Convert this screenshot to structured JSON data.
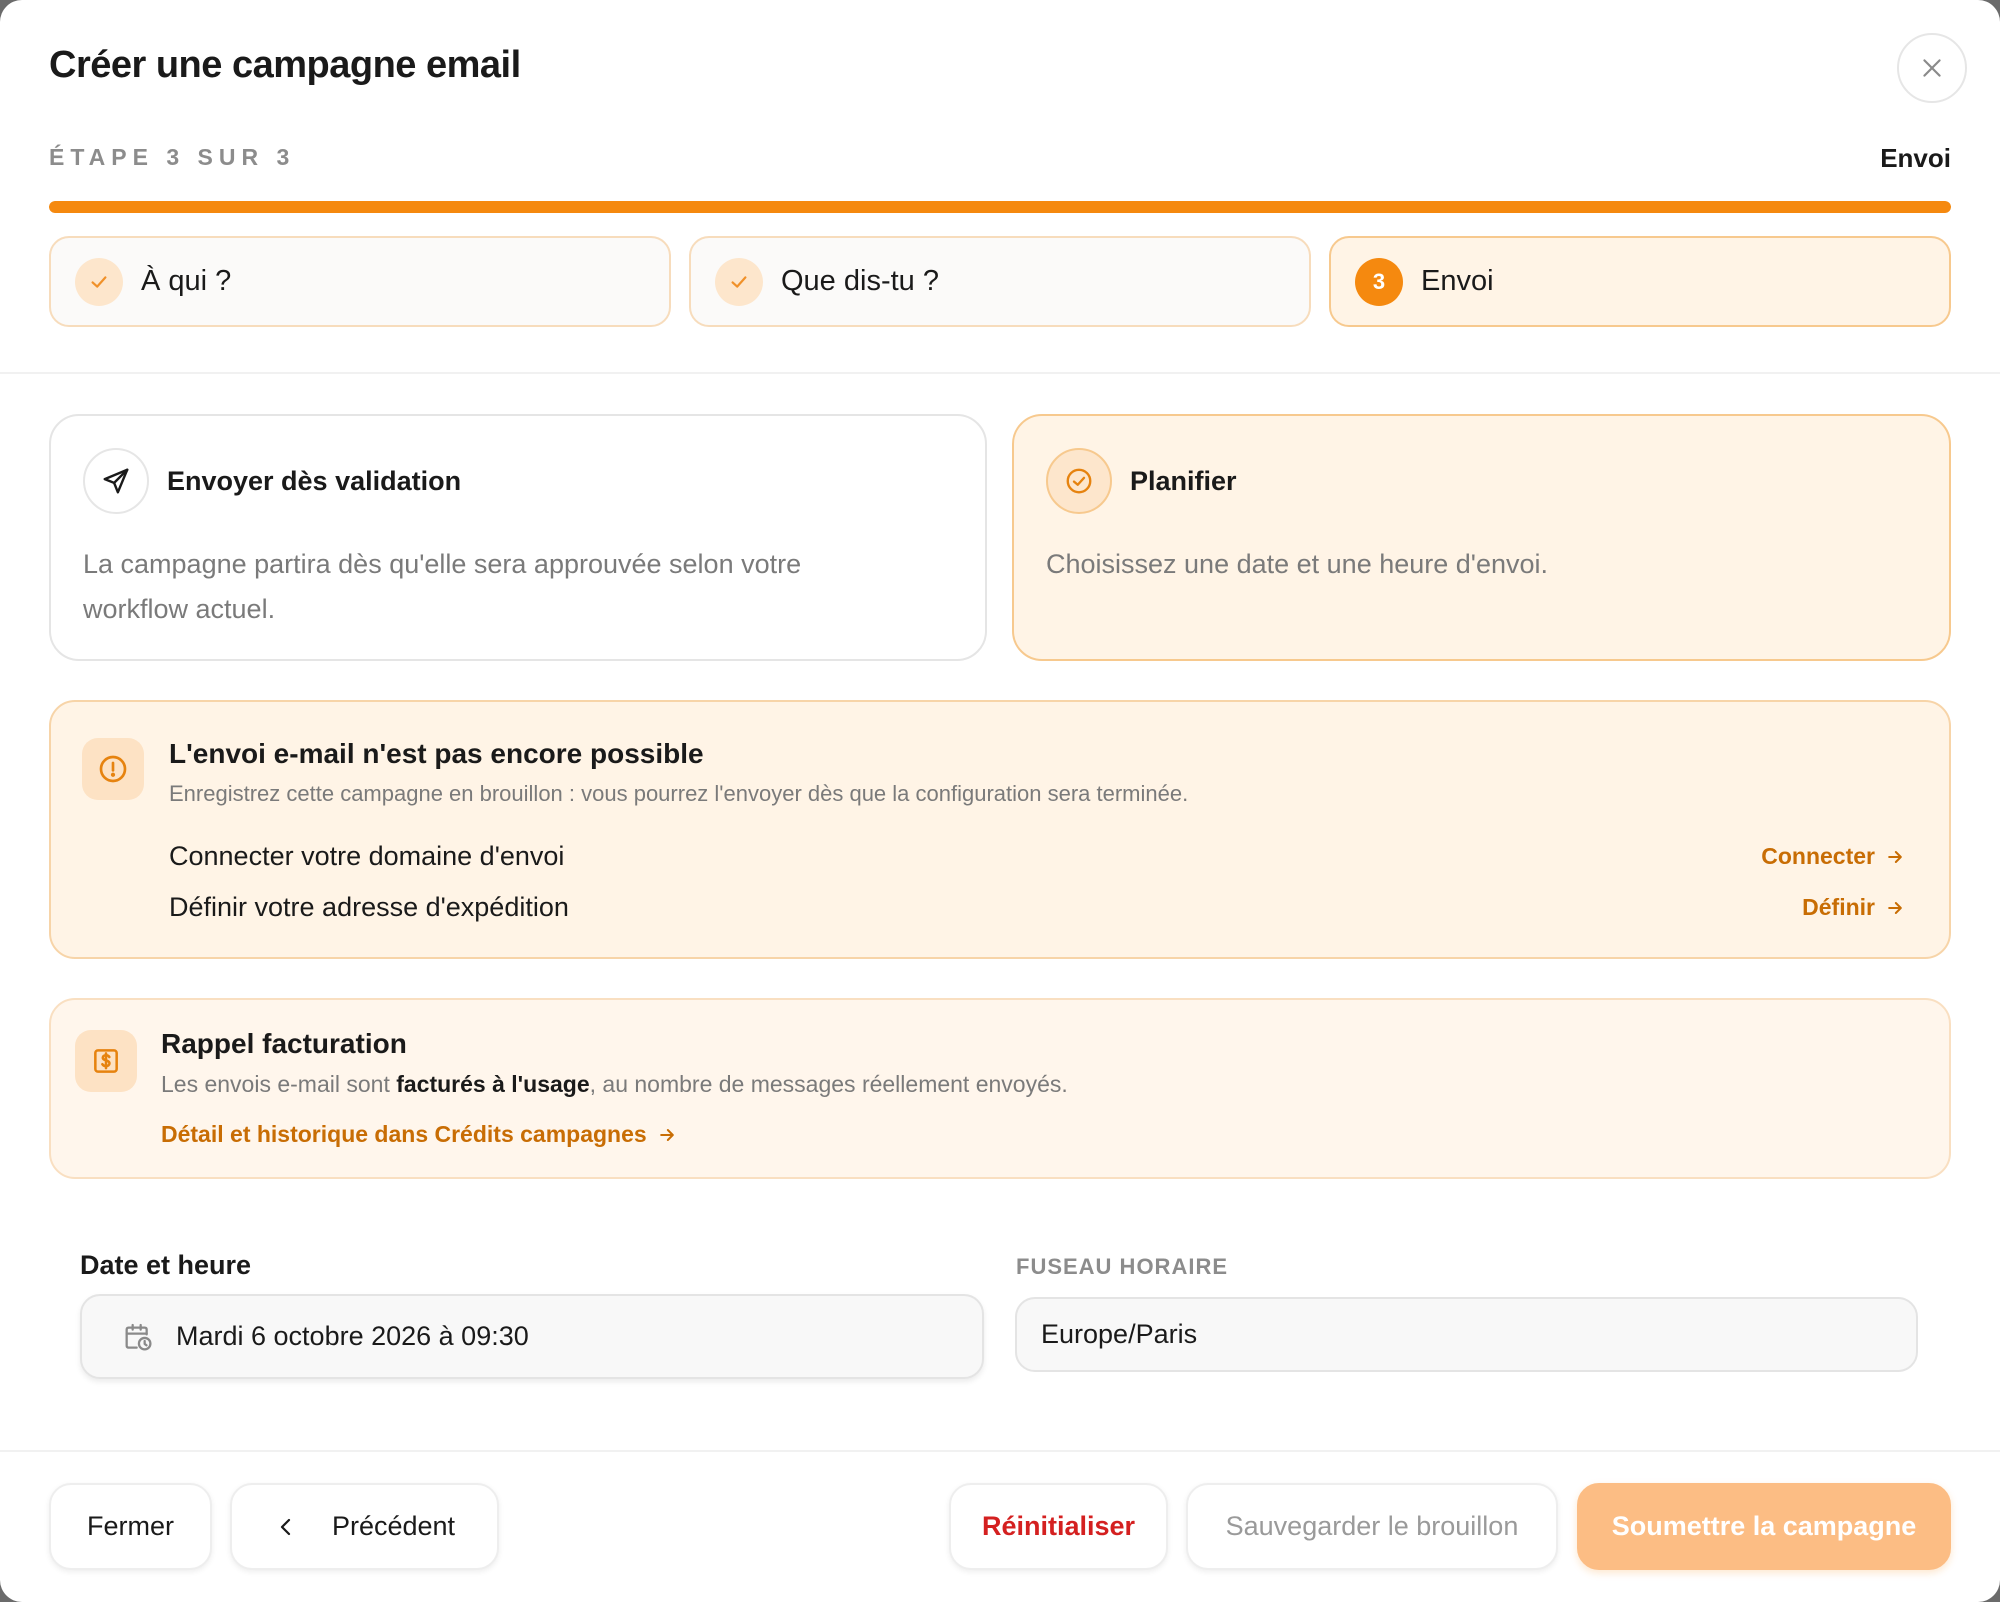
{
  "modal": {
    "title": "Créer une campagne email"
  },
  "progress": {
    "step_label": "ÉTAPE 3 SUR 3",
    "step_name": "Envoi",
    "percent": 100,
    "color": "#f5890f"
  },
  "steps": [
    {
      "label": "À qui ?",
      "state": "done",
      "icon": "check-icon"
    },
    {
      "label": "Que dis-tu ?",
      "state": "done",
      "icon": "check-icon"
    },
    {
      "label": "Envoi",
      "state": "active",
      "number": "3"
    }
  ],
  "send_options": {
    "immediate": {
      "icon": "send-icon",
      "title": "Envoyer dès validation",
      "description": "La campagne partira dès qu'elle sera approuvée selon votre workflow actuel."
    },
    "schedule": {
      "icon": "check-circle-icon",
      "title": "Planifier",
      "description": "Choisissez une date et une heure d'envoi.",
      "selected": true
    }
  },
  "alert": {
    "icon": "alert-circle-icon",
    "title": "L'envoi e-mail n'est pas encore possible",
    "subtitle": "Enregistrez cette campagne en brouillon : vous pourrez l'envoyer dès que la configuration sera terminée.",
    "tasks": [
      {
        "label": "Connecter votre domaine d'envoi",
        "action": "Connecter"
      },
      {
        "label": "Définir votre adresse d'expédition",
        "action": "Définir"
      }
    ]
  },
  "billing": {
    "icon": "billing-icon",
    "title": "Rappel facturation",
    "text_before": "Les envois e-mail sont ",
    "text_bold": "facturés à l'usage",
    "text_after": ", au nombre de messages réellement envoyés.",
    "link": "Détail et historique dans Crédits campagnes"
  },
  "schedule_fields": {
    "date_label": "Date et heure",
    "date_value": "Mardi 6 octobre 2026 à 09:30",
    "timezone_label": "FUSEAU HORAIRE",
    "timezone_value": "Europe/Paris"
  },
  "footer": {
    "close": "Fermer",
    "previous": "Précédent",
    "reset": "Réinitialiser",
    "save_draft": "Sauvegarder le brouillon",
    "submit": "Soumettre la campagne"
  },
  "colors": {
    "accent": "#f5890f",
    "link": "#c86d04",
    "danger": "#d42020"
  }
}
